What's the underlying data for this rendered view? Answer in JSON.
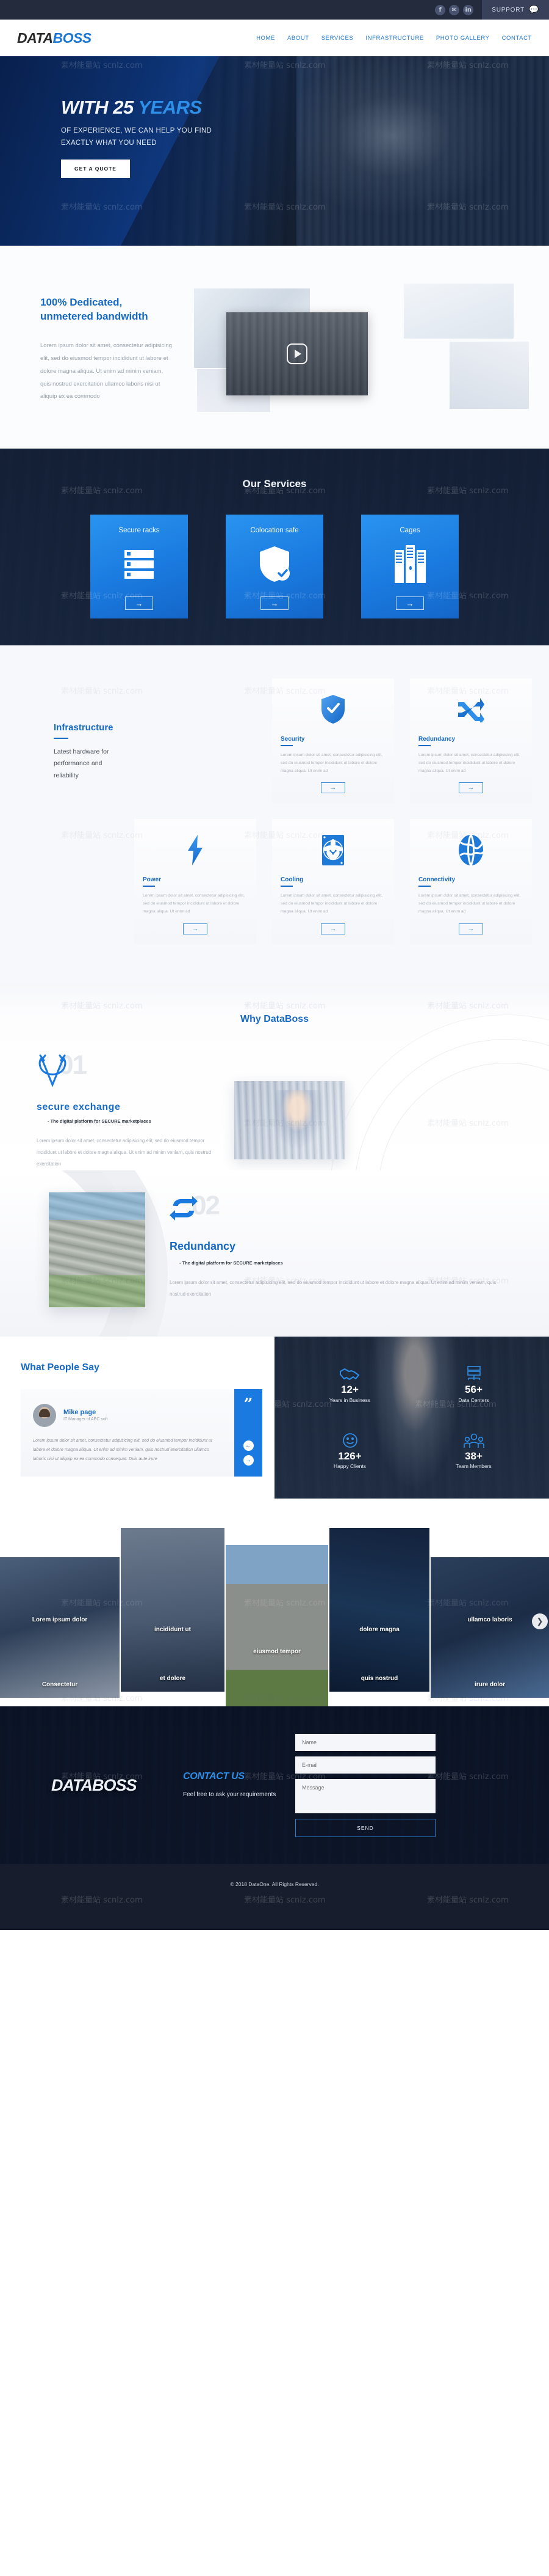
{
  "topbar": {
    "social": [
      {
        "name": "facebook-icon",
        "glyph": "f"
      },
      {
        "name": "twitter-icon",
        "glyph": "✉"
      },
      {
        "name": "linkedin-icon",
        "glyph": "in"
      }
    ],
    "support_label": "SUPPORT",
    "support_icon": "headset-agent-icon"
  },
  "nav": {
    "logo_part1": "DATA",
    "logo_part2": "BOSS",
    "links": [
      {
        "label": "HOME"
      },
      {
        "label": "ABOUT"
      },
      {
        "label": "SERVICES"
      },
      {
        "label": "INFRASTRUCTURE"
      },
      {
        "label": "PHOTO GALLERY"
      },
      {
        "label": "CONTACT"
      }
    ]
  },
  "hero": {
    "title_pre": "WITH 25 ",
    "title_accent": "YEARS",
    "subtitle_line1": "OF EXPERIENCE, WE CAN HELP YOU FIND",
    "subtitle_line2": "EXACTLY WHAT YOU NEED",
    "cta": "GET A QUOTE"
  },
  "dedicated": {
    "title_line1": "100% Dedicated,",
    "title_line2": "unmetered bandwidth",
    "body": "Lorem ipsum dolor sit amet, consectetur adipisicing elit, sed do eiusmod tempor incididunt ut labore et dolore magna aliqua. Ut enim ad minim veniam, quis nostrud exercitation ullamco laboris nisi ut aliquip ex ea commodo",
    "video_icon": "play-button-icon"
  },
  "services": {
    "title": "Our Services",
    "cards": [
      {
        "label": "Secure racks",
        "icon": "server-rack-icon",
        "arrow": "→"
      },
      {
        "label": "Colocation safe",
        "icon": "shield-check-icon",
        "arrow": "→"
      },
      {
        "label": "Cages",
        "icon": "server-cabinets-icon",
        "arrow": "→"
      }
    ]
  },
  "infrastructure": {
    "title": "Infrastructure",
    "tagline": "Latest hardware for performance and reliability",
    "body_text": "Lorem ipsum dolor sit amet, consectetur adipisicing elit, sed do eiusmod tempor incididunt ut labore et dolore magna aliqua. Ut enim ad",
    "arrow": "→",
    "cards": [
      {
        "title": "Security",
        "icon": "shield-check-icon"
      },
      {
        "title": "Redundancy",
        "icon": "shuffle-arrows-icon"
      },
      {
        "title": "Power",
        "icon": "lightning-bolt-icon"
      },
      {
        "title": "Cooling",
        "icon": "fan-icon"
      },
      {
        "title": "Connectivity",
        "icon": "globe-network-icon"
      }
    ]
  },
  "why": {
    "title": "Why DataBoss",
    "item1": {
      "number": "01",
      "icon": "secure-exchange-icon",
      "heading": "secure exchange",
      "subheading": "- The digital platform for SECURE marketplaces",
      "body": "Lorem ipsum dolor sit amet, consectetur adipisicing elit, sed do eiusmod tempor incididunt ut labore et dolore magna aliqua. Ut enim ad minim veniam, quis nostrud exercitation",
      "image_alt": "technicians-working-in-server-room"
    },
    "item2": {
      "number": "02",
      "icon": "redundancy-loop-icon",
      "heading": "Redundancy",
      "subheading": "- The digital platform for SECURE marketplaces",
      "body": "Lorem ipsum dolor sit amet, consectetur adipisicing elit, sed do eiusmod tempor incididunt ut labore et dolore magna aliqua. Ut enim ad minim veniam, quis nostrud exercitation",
      "image_alt": "databoss-building-exterior"
    }
  },
  "testimonials": {
    "title": "What People Say",
    "name": "Mike page",
    "role": "IT Manager of ABC soft",
    "quote": "Lorem ipsum dolor sit amet, consectetur adipisicing elit, sed do eiusmod tempor incididunt ut labore et dolore magna aliqua. Ut enim ad minim veniam, quis nostrud exercitation ullamco laboris nisi ut aliquip ex ea commodo consequat. Duis aute irure",
    "quote_mark": "”",
    "prev": "←",
    "next": "→"
  },
  "stats": [
    {
      "value": "12+",
      "label": "Years in Business",
      "icon": "handshake-icon"
    },
    {
      "value": "56+",
      "label": "Data Centers",
      "icon": "server-stack-icon"
    },
    {
      "value": "126+",
      "label": "Happy Clients",
      "icon": "smiley-face-icon"
    },
    {
      "value": "38+",
      "label": "Team Members",
      "icon": "team-people-icon"
    }
  ],
  "gallery": {
    "next_arrow": "❯",
    "items": [
      {
        "caption_top": "Lorem ipsum dolor",
        "caption_bottom": "Consectetur"
      },
      {
        "caption_top": "incididunt ut",
        "caption_bottom": "et dolore"
      },
      {
        "caption_top": "",
        "caption_bottom": "eiusmod tempor"
      },
      {
        "caption_top": "dolore magna",
        "caption_bottom": "quis nostrud"
      },
      {
        "caption_top": "ullamco laboris",
        "caption_bottom": "irure dolor"
      }
    ]
  },
  "contact": {
    "logo": "DATABOSS",
    "title": "CONTACT US",
    "subtitle": "Feel free to ask your requirements",
    "name_placeholder": "Name",
    "email_placeholder": "E-mail",
    "message_placeholder": "Message",
    "send_label": "SEND"
  },
  "footer": {
    "copyright": "© 2018 DataOne. All Rights Reserved."
  },
  "colors": {
    "accent": "#1a7adf",
    "heading_blue": "#1669c4",
    "dark": "#171d2c"
  },
  "watermark": "素材能量站 scnlz.com"
}
